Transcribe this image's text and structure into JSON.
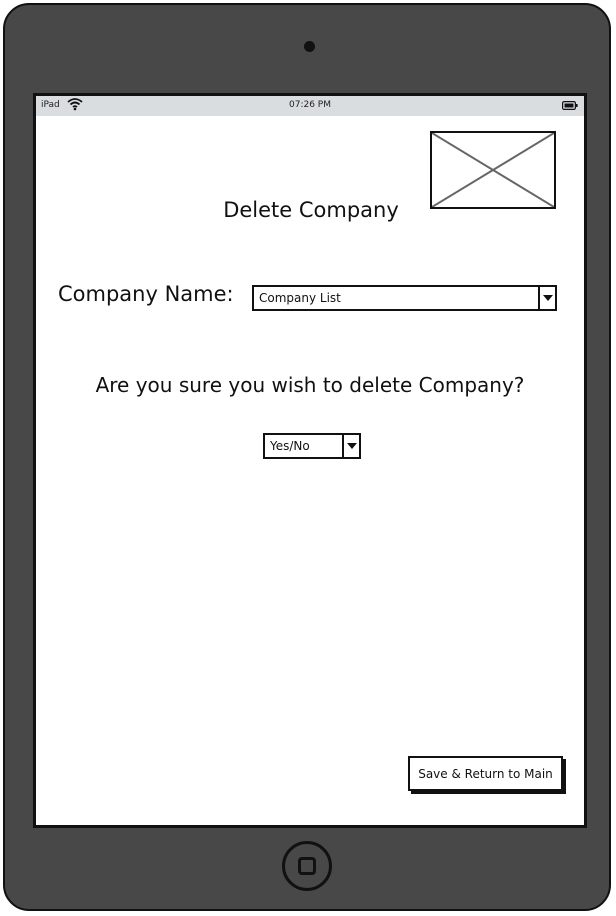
{
  "status_bar": {
    "carrier": "iPad",
    "time": "07:26 PM"
  },
  "form": {
    "title": "Delete Company",
    "company_label": "Company Name:",
    "company_select_value": "Company List",
    "question": "Are you sure you wish to delete Company?",
    "confirm_select_value": "Yes/No"
  },
  "actions": {
    "save_label": "Save & Return to Main"
  },
  "icons": {
    "wifi": "wifi-icon",
    "battery": "battery-icon",
    "image_placeholder": "image-placeholder-icon",
    "dropdown": "chevron-down-icon",
    "home": "home-button-icon"
  },
  "colors": {
    "device_frame": "#484848",
    "status_bar_bg": "#d9dde0",
    "screen_bg": "#ffffff",
    "ink": "#111111"
  }
}
